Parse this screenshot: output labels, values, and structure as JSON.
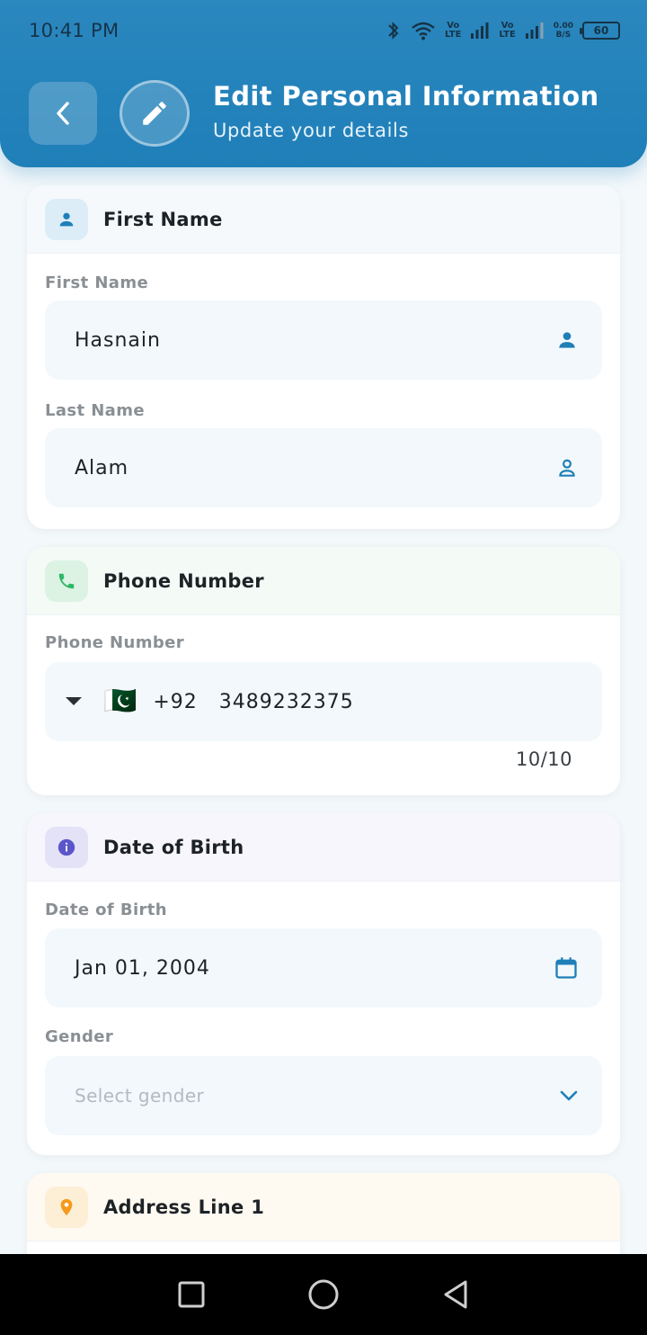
{
  "status_bar": {
    "time": "10:41 PM",
    "net1": "Vo\nLTE",
    "net2": "Vo\nLTE",
    "speed": "0.00\nB/S",
    "battery": "60"
  },
  "header": {
    "title": "Edit Personal Information",
    "subtitle": "Update your details"
  },
  "name_card": {
    "title": "First Name",
    "first_label": "First Name",
    "first_value": "Hasnain",
    "last_label": "Last Name",
    "last_value": "Alam",
    "accent": "#1f7fb8"
  },
  "phone_card": {
    "title": "Phone Number",
    "label": "Phone Number",
    "flag": "🇵🇰",
    "dial_code": "+92",
    "number": "3489232375",
    "counter": "10/10",
    "accent": "#2fb866"
  },
  "dob_card": {
    "title": "Date of Birth",
    "dob_label": "Date of Birth",
    "dob_value": "Jan 01, 2004",
    "gender_label": "Gender",
    "gender_placeholder": "Select gender",
    "accent": "#5b55c9"
  },
  "address_card": {
    "title": "Address Line 1",
    "accent": "#f59a1c"
  }
}
